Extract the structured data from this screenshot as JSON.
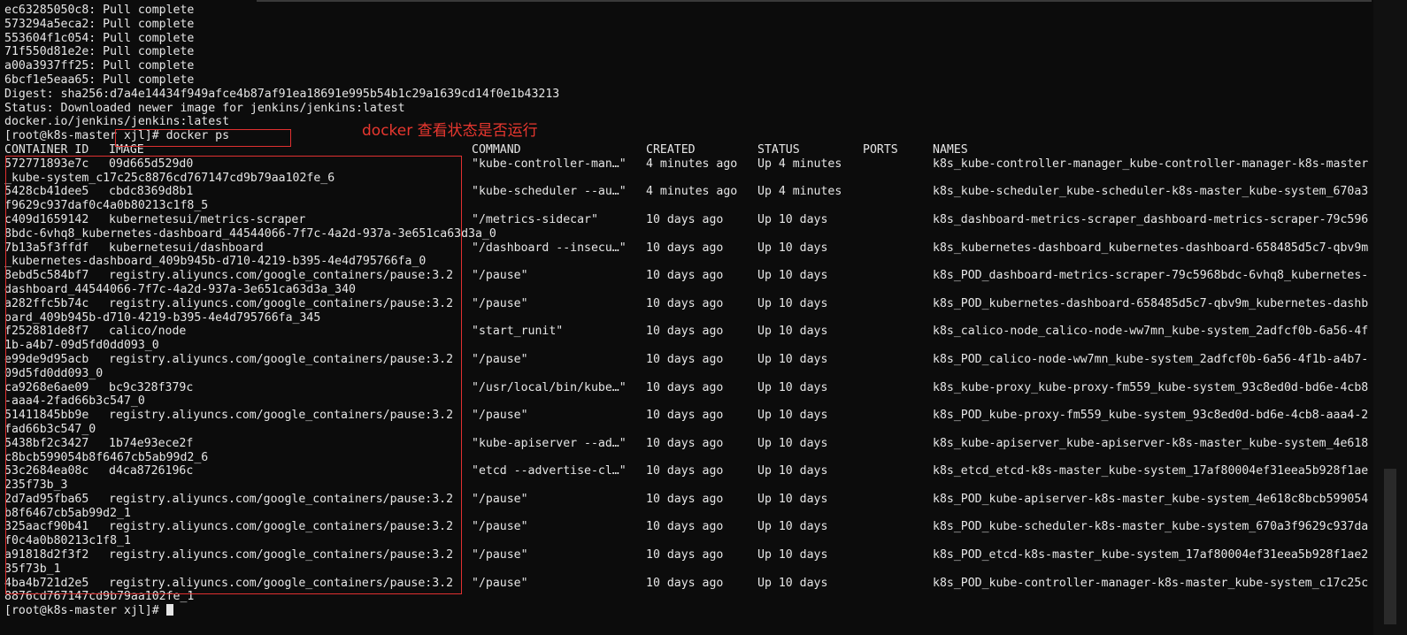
{
  "pull_lines": [
    "ec63285050c8: Pull complete",
    "573294a5eca2: Pull complete",
    "553604f1c054: Pull complete",
    "71f550d81e2e: Pull complete",
    "a00a3937ff25: Pull complete",
    "6bcf1e5eaa65: Pull complete",
    "Digest: sha256:d7a4e14434f949afce4b87af91ea18691e995b54b1c29a1639cd14f0e1b43213",
    "Status: Downloaded newer image for jenkins/jenkins:latest",
    "docker.io/jenkins/jenkins:latest"
  ],
  "prompt_command": "[root@k8s-master xjl]# docker ps",
  "annotation": "docker 查看状态是否运行",
  "headers": {
    "container_id": "CONTAINER ID",
    "image": "IMAGE",
    "command": "COMMAND",
    "created": "CREATED",
    "status": "STATUS",
    "ports": "PORTS",
    "names": "NAMES"
  },
  "rows": [
    {
      "id": "572771893e7c",
      "image": "09d665d529d0",
      "command": "\"kube-controller-man…\"",
      "created": "4 minutes ago",
      "status": "Up 4 minutes",
      "names": "k8s_kube-controller-manager_kube-controller-manager-k8s-master",
      "wrap": "_kube-system_c17c25c8876cd767147cd9b79aa102fe_6"
    },
    {
      "id": "5428cb41dee5",
      "image": "cbdc8369d8b1",
      "command": "\"kube-scheduler --au…\"",
      "created": "4 minutes ago",
      "status": "Up 4 minutes",
      "names": "k8s_kube-scheduler_kube-scheduler-k8s-master_kube-system_670a3",
      "wrap": "f9629c937daf0c4a0b80213c1f8_5"
    },
    {
      "id": "c409d1659142",
      "image": "kubernetesui/metrics-scraper",
      "command": "\"/metrics-sidecar\"",
      "created": "10 days ago",
      "status": "Up 10 days",
      "names": "k8s_dashboard-metrics-scraper_dashboard-metrics-scraper-79c596",
      "wrap": "8bdc-6vhq8_kubernetes-dashboard_44544066-7f7c-4a2d-937a-3e651ca63d3a_0"
    },
    {
      "id": "7b13a5f3ffdf",
      "image": "kubernetesui/dashboard",
      "command": "\"/dashboard --insecu…\"",
      "created": "10 days ago",
      "status": "Up 10 days",
      "names": "k8s_kubernetes-dashboard_kubernetes-dashboard-658485d5c7-qbv9m",
      "wrap": "_kubernetes-dashboard_409b945b-d710-4219-b395-4e4d795766fa_0"
    },
    {
      "id": "8ebd5c584bf7",
      "image": "registry.aliyuncs.com/google_containers/pause:3.2",
      "command": "\"/pause\"",
      "created": "10 days ago",
      "status": "Up 10 days",
      "names": "k8s_POD_dashboard-metrics-scraper-79c5968bdc-6vhq8_kubernetes-",
      "wrap": "dashboard_44544066-7f7c-4a2d-937a-3e651ca63d3a_340"
    },
    {
      "id": "a282ffc5b74c",
      "image": "registry.aliyuncs.com/google_containers/pause:3.2",
      "command": "\"/pause\"",
      "created": "10 days ago",
      "status": "Up 10 days",
      "names": "k8s_POD_kubernetes-dashboard-658485d5c7-qbv9m_kubernetes-dashb",
      "wrap": "oard_409b945b-d710-4219-b395-4e4d795766fa_345"
    },
    {
      "id": "f252881de8f7",
      "image": "calico/node",
      "command": "\"start_runit\"",
      "created": "10 days ago",
      "status": "Up 10 days",
      "names": "k8s_calico-node_calico-node-ww7mn_kube-system_2adfcf0b-6a56-4f",
      "wrap": "1b-a4b7-09d5fd0dd093_0"
    },
    {
      "id": "e99de9d95acb",
      "image": "registry.aliyuncs.com/google_containers/pause:3.2",
      "command": "\"/pause\"",
      "created": "10 days ago",
      "status": "Up 10 days",
      "names": "k8s_POD_calico-node-ww7mn_kube-system_2adfcf0b-6a56-4f1b-a4b7-",
      "wrap": "09d5fd0dd093_0"
    },
    {
      "id": "ca9268e6ae09",
      "image": "bc9c328f379c",
      "command": "\"/usr/local/bin/kube…\"",
      "created": "10 days ago",
      "status": "Up 10 days",
      "names": "k8s_kube-proxy_kube-proxy-fm559_kube-system_93c8ed0d-bd6e-4cb8",
      "wrap": "-aaa4-2fad66b3c547_0"
    },
    {
      "id": "51411845bb9e",
      "image": "registry.aliyuncs.com/google_containers/pause:3.2",
      "command": "\"/pause\"",
      "created": "10 days ago",
      "status": "Up 10 days",
      "names": "k8s_POD_kube-proxy-fm559_kube-system_93c8ed0d-bd6e-4cb8-aaa4-2",
      "wrap": "fad66b3c547_0"
    },
    {
      "id": "5438bf2c3427",
      "image": "1b74e93ece2f",
      "command": "\"kube-apiserver --ad…\"",
      "created": "10 days ago",
      "status": "Up 10 days",
      "names": "k8s_kube-apiserver_kube-apiserver-k8s-master_kube-system_4e618",
      "wrap": "c8bcb599054b8f6467cb5ab99d2_6"
    },
    {
      "id": "53c2684ea08c",
      "image": "d4ca8726196c",
      "command": "\"etcd --advertise-cl…\"",
      "created": "10 days ago",
      "status": "Up 10 days",
      "names": "k8s_etcd_etcd-k8s-master_kube-system_17af80004ef31eea5b928f1ae",
      "wrap": "235f73b_3"
    },
    {
      "id": "2d7ad95fba65",
      "image": "registry.aliyuncs.com/google_containers/pause:3.2",
      "command": "\"/pause\"",
      "created": "10 days ago",
      "status": "Up 10 days",
      "names": "k8s_POD_kube-apiserver-k8s-master_kube-system_4e618c8bcb599054",
      "wrap": "b8f6467cb5ab99d2_1"
    },
    {
      "id": "325aacf90b41",
      "image": "registry.aliyuncs.com/google_containers/pause:3.2",
      "command": "\"/pause\"",
      "created": "10 days ago",
      "status": "Up 10 days",
      "names": "k8s_POD_kube-scheduler-k8s-master_kube-system_670a3f9629c937da",
      "wrap": "f0c4a0b80213c1f8_1"
    },
    {
      "id": "a91818d2f3f2",
      "image": "registry.aliyuncs.com/google_containers/pause:3.2",
      "command": "\"/pause\"",
      "created": "10 days ago",
      "status": "Up 10 days",
      "names": "k8s_POD_etcd-k8s-master_kube-system_17af80004ef31eea5b928f1ae2",
      "wrap": "35f73b_1"
    },
    {
      "id": "4ba4b721d2e5",
      "image": "registry.aliyuncs.com/google_containers/pause:3.2",
      "command": "\"/pause\"",
      "created": "10 days ago",
      "status": "Up 10 days",
      "names": "k8s_POD_kube-controller-manager-k8s-master_kube-system_c17c25c",
      "wrap": "8876cd767147cd9b79aa102fe_1"
    }
  ],
  "final_prompt": "[root@k8s-master xjl]# ",
  "colors": {
    "background": "#0c0c0c",
    "foreground": "#e6e6e6",
    "annotation": "#e03030"
  }
}
